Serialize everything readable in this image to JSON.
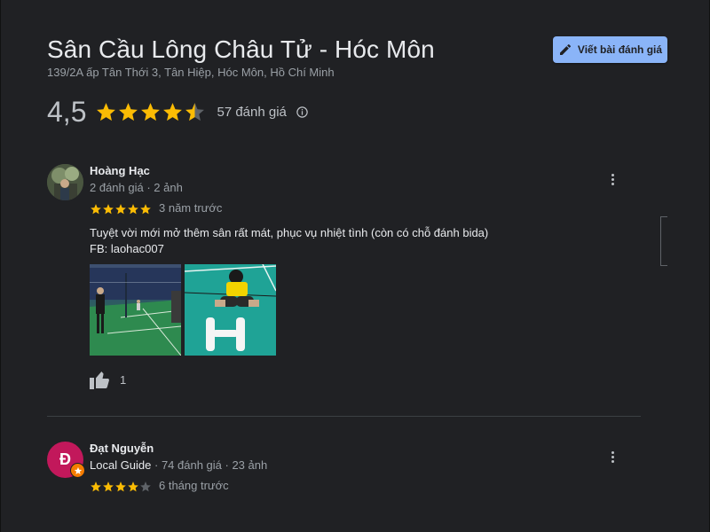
{
  "place": {
    "title": "Sân Cầu Lông Châu Tử - Hóc Môn",
    "address": "139/2A ấp Tân Thới 3, Tân Hiệp, Hóc Môn, Hồ Chí Minh"
  },
  "actions": {
    "write_review_label": "Viết bài đánh giá",
    "write_review_icon": "pencil-icon"
  },
  "rating": {
    "score": "4,5",
    "stars": 4.5,
    "count_label": "57 đánh giá",
    "info_icon": "info-icon"
  },
  "colors": {
    "star": "#fbbc04",
    "star_empty": "#5f6368",
    "accent": "#8ab4f8",
    "avatar_2": "#c2185b",
    "local_guide_badge": "#f57c00"
  },
  "reviews": [
    {
      "name": "Hoàng Hạc",
      "meta": "2 đánh giá · 2 ảnh",
      "stars": 5,
      "time": "3 năm trước",
      "text_line1": "Tuyệt vời mới mở thêm sân rất mát, phục vụ nhiệt tình (còn có chỗ đánh bida)",
      "text_line2": "FB: laohac007",
      "likes": "1",
      "like_icon": "thumbs-up-icon",
      "more_icon": "more-vert-icon"
    },
    {
      "name": "Đạt Nguyễn",
      "avatar_letter": "Đ",
      "local_guide": "Local Guide",
      "meta": " · 74 đánh giá · 23 ảnh",
      "stars": 4,
      "time": "6 tháng trước",
      "more_icon": "more-vert-icon"
    }
  ]
}
